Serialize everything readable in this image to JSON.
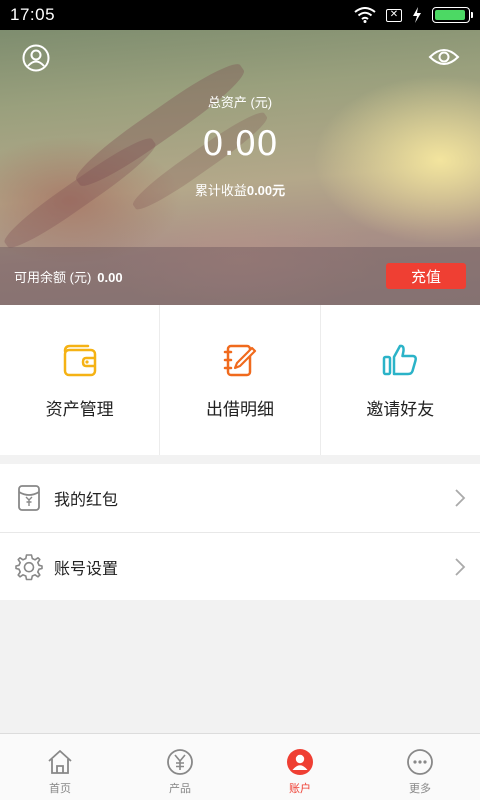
{
  "status_bar": {
    "time": "17:05",
    "battery_level": 0.95,
    "icons": [
      "wifi-icon",
      "sim-off-icon",
      "charging-icon",
      "battery-icon"
    ]
  },
  "hero": {
    "total_assets_label": "总资产 (元)",
    "total_assets_value": "0.00",
    "income_label": "累计收益",
    "income_value": "0.00元",
    "balance_label": "可用余额 (元)",
    "balance_value": "0.00",
    "recharge_label": "充值",
    "icons": [
      "user-avatar-icon",
      "eye-icon"
    ]
  },
  "quick_actions": [
    {
      "label": "资产管理",
      "icon": "wallet-icon",
      "color": "#f5b214"
    },
    {
      "label": "出借明细",
      "icon": "notebook-pen-icon",
      "color": "#f06a1d"
    },
    {
      "label": "邀请好友",
      "icon": "thumbs-up-icon",
      "color": "#2bb3c8"
    }
  ],
  "menu": [
    {
      "label": "我的红包",
      "icon": "red-packet-icon"
    },
    {
      "label": "账号设置",
      "icon": "gear-icon"
    }
  ],
  "bottom_nav": [
    {
      "label": "首页",
      "icon": "home-icon",
      "active": false
    },
    {
      "label": "产品",
      "icon": "yen-icon",
      "active": false
    },
    {
      "label": "账户",
      "icon": "account-icon",
      "active": true
    },
    {
      "label": "更多",
      "icon": "more-icon",
      "active": false
    }
  ],
  "colors": {
    "accent": "#ef3f33",
    "status_bar": "#000000",
    "battery": "#4cd964"
  }
}
